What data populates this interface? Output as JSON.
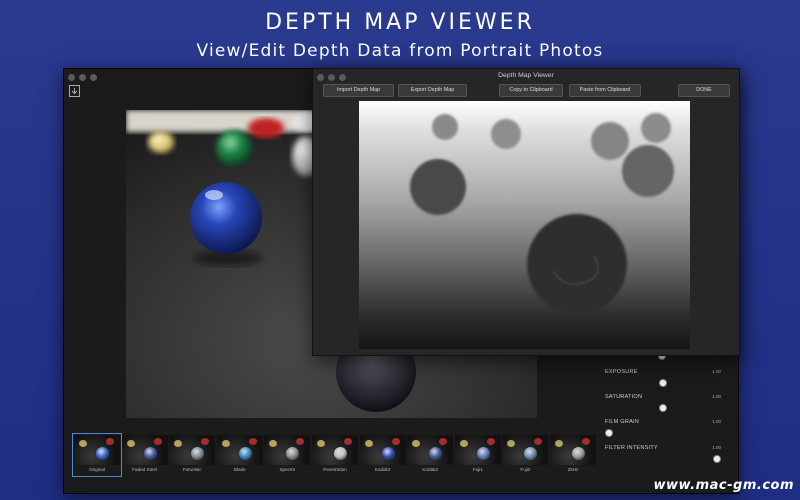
{
  "hero": {
    "title": "DEPTH MAP VIEWER",
    "subtitle": "View/Edit Depth Data from Portrait Photos"
  },
  "depth_window": {
    "title": "Depth Map Viewer",
    "buttons": {
      "import": "Import Depth Map",
      "export": "Export Depth Map",
      "copy": "Copy to Clipboard",
      "paste": "Paste from Clipboard",
      "done": "DONE"
    }
  },
  "main_window": {
    "toolbar_icon": "download-icon",
    "filters": [
      "Original",
      "Faded Steel",
      "Futuristic",
      "Blade",
      "Spectre",
      "Penetration",
      "Kodak2",
      "Kodak3",
      "Fuji1",
      "Fuji2",
      "25Hz"
    ],
    "selected_filter": "Original",
    "adjustments": [
      {
        "name": "EXPOSURE",
        "value": "1.00",
        "level": 0.5
      },
      {
        "name": "SATURATION",
        "value": "1.00",
        "level": 0.5
      },
      {
        "name": "FILM GRAIN",
        "value": "1.00",
        "level": 0.0
      },
      {
        "name": "FILTER INTENSITY",
        "value": "1.00",
        "level": 1.0
      }
    ]
  },
  "watermark": "www.mac-gm.com",
  "colors": {
    "background": "#2a3a8f",
    "window": "#1b1b1b",
    "accent": "#4f86d8"
  }
}
